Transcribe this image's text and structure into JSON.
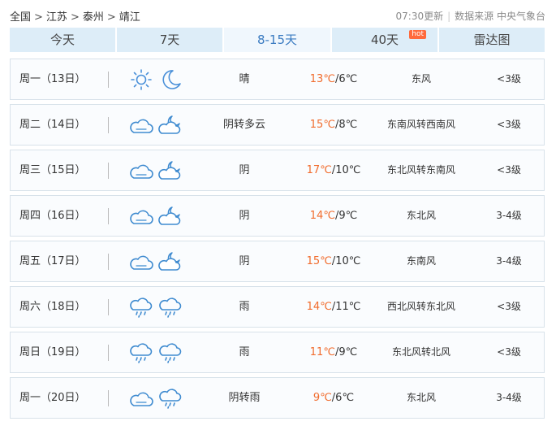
{
  "breadcrumb": {
    "items": [
      "全国",
      "江苏",
      "泰州",
      "靖江"
    ],
    "separator": ">"
  },
  "source": {
    "update_time": "07:30更新",
    "source_text": "数据来源 中央气象台",
    "divider": "|"
  },
  "tabs": [
    {
      "label": "今天",
      "active": false
    },
    {
      "label": "7天",
      "active": false
    },
    {
      "label": "8-15天",
      "active": true
    },
    {
      "label": "40天",
      "active": false,
      "badge": "hot"
    },
    {
      "label": "雷达图",
      "active": false
    }
  ],
  "colors": {
    "tab_bg": "#ddedf8",
    "tab_active_bg": "#f0f7fd",
    "tab_active_text": "#3a7bc1",
    "high_temp": "#f16c2d",
    "icon_stroke": "#3f8bd0",
    "sun": "#4a90d9",
    "hot_badge": "#ff6a3c"
  },
  "forecast": [
    {
      "day": "周一（13日）",
      "icon_day": "sunny-icon",
      "icon_night": "moon-icon",
      "desc": "晴",
      "high": "13℃",
      "low": "/6℃",
      "wind": "东风",
      "level": "<3级"
    },
    {
      "day": "周二（14日）",
      "icon_day": "overcast-icon",
      "icon_night": "cloud-moon-icon",
      "desc": "阴转多云",
      "high": "15℃",
      "low": "/8℃",
      "wind": "东南风转西南风",
      "level": "<3级"
    },
    {
      "day": "周三（15日）",
      "icon_day": "overcast-icon",
      "icon_night": "cloud-moon-icon",
      "desc": "阴",
      "high": "17℃",
      "low": "/10℃",
      "wind": "东北风转东南风",
      "level": "<3级"
    },
    {
      "day": "周四（16日）",
      "icon_day": "overcast-icon",
      "icon_night": "cloud-moon-icon",
      "desc": "阴",
      "high": "14℃",
      "low": "/9℃",
      "wind": "东北风",
      "level": "3-4级"
    },
    {
      "day": "周五（17日）",
      "icon_day": "overcast-icon",
      "icon_night": "cloud-moon-icon",
      "desc": "阴",
      "high": "15℃",
      "low": "/10℃",
      "wind": "东南风",
      "level": "3-4级"
    },
    {
      "day": "周六（18日）",
      "icon_day": "rain-icon",
      "icon_night": "rain-icon",
      "desc": "雨",
      "high": "14℃",
      "low": "/11℃",
      "wind": "西北风转东北风",
      "level": "<3级"
    },
    {
      "day": "周日（19日）",
      "icon_day": "rain-icon",
      "icon_night": "rain-icon",
      "desc": "雨",
      "high": "11℃",
      "low": "/9℃",
      "wind": "东北风转北风",
      "level": "<3级"
    },
    {
      "day": "周一（20日）",
      "icon_day": "overcast-icon",
      "icon_night": "rain-icon",
      "desc": "阴转雨",
      "high": "9℃",
      "low": "/6℃",
      "wind": "东北风",
      "level": "3-4级"
    }
  ]
}
